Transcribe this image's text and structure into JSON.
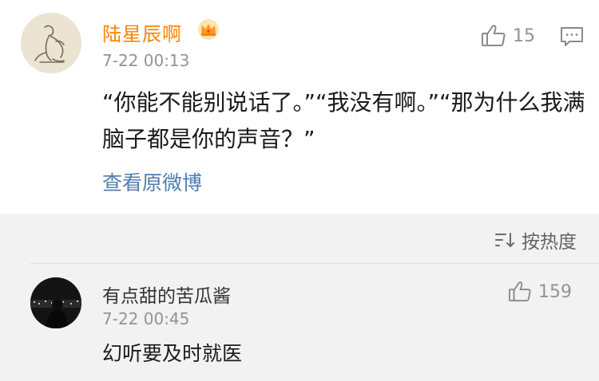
{
  "post": {
    "username": "陆星辰啊",
    "time": "7-22 00:13",
    "like_count": "15",
    "text": "“你能不能别说话了。”“我没有啊。”“那为什么我满脑子都是你的声音？”",
    "view_original": "查看原微博"
  },
  "icons": {
    "crown": "crown-badge-icon",
    "like": "thumbs-up-icon",
    "comment": "comment-icon",
    "sort": "sort-icon"
  },
  "colors": {
    "username": "#ff8200",
    "link": "#507daf",
    "muted": "#939393",
    "comments_bg": "#f2f2f2"
  },
  "comments": {
    "sort_label": "按热度",
    "items": [
      {
        "username": "有点甜的苦瓜酱",
        "time": "7-22 00:45",
        "like_count": "159",
        "text": "幻听要及时就医"
      }
    ]
  }
}
